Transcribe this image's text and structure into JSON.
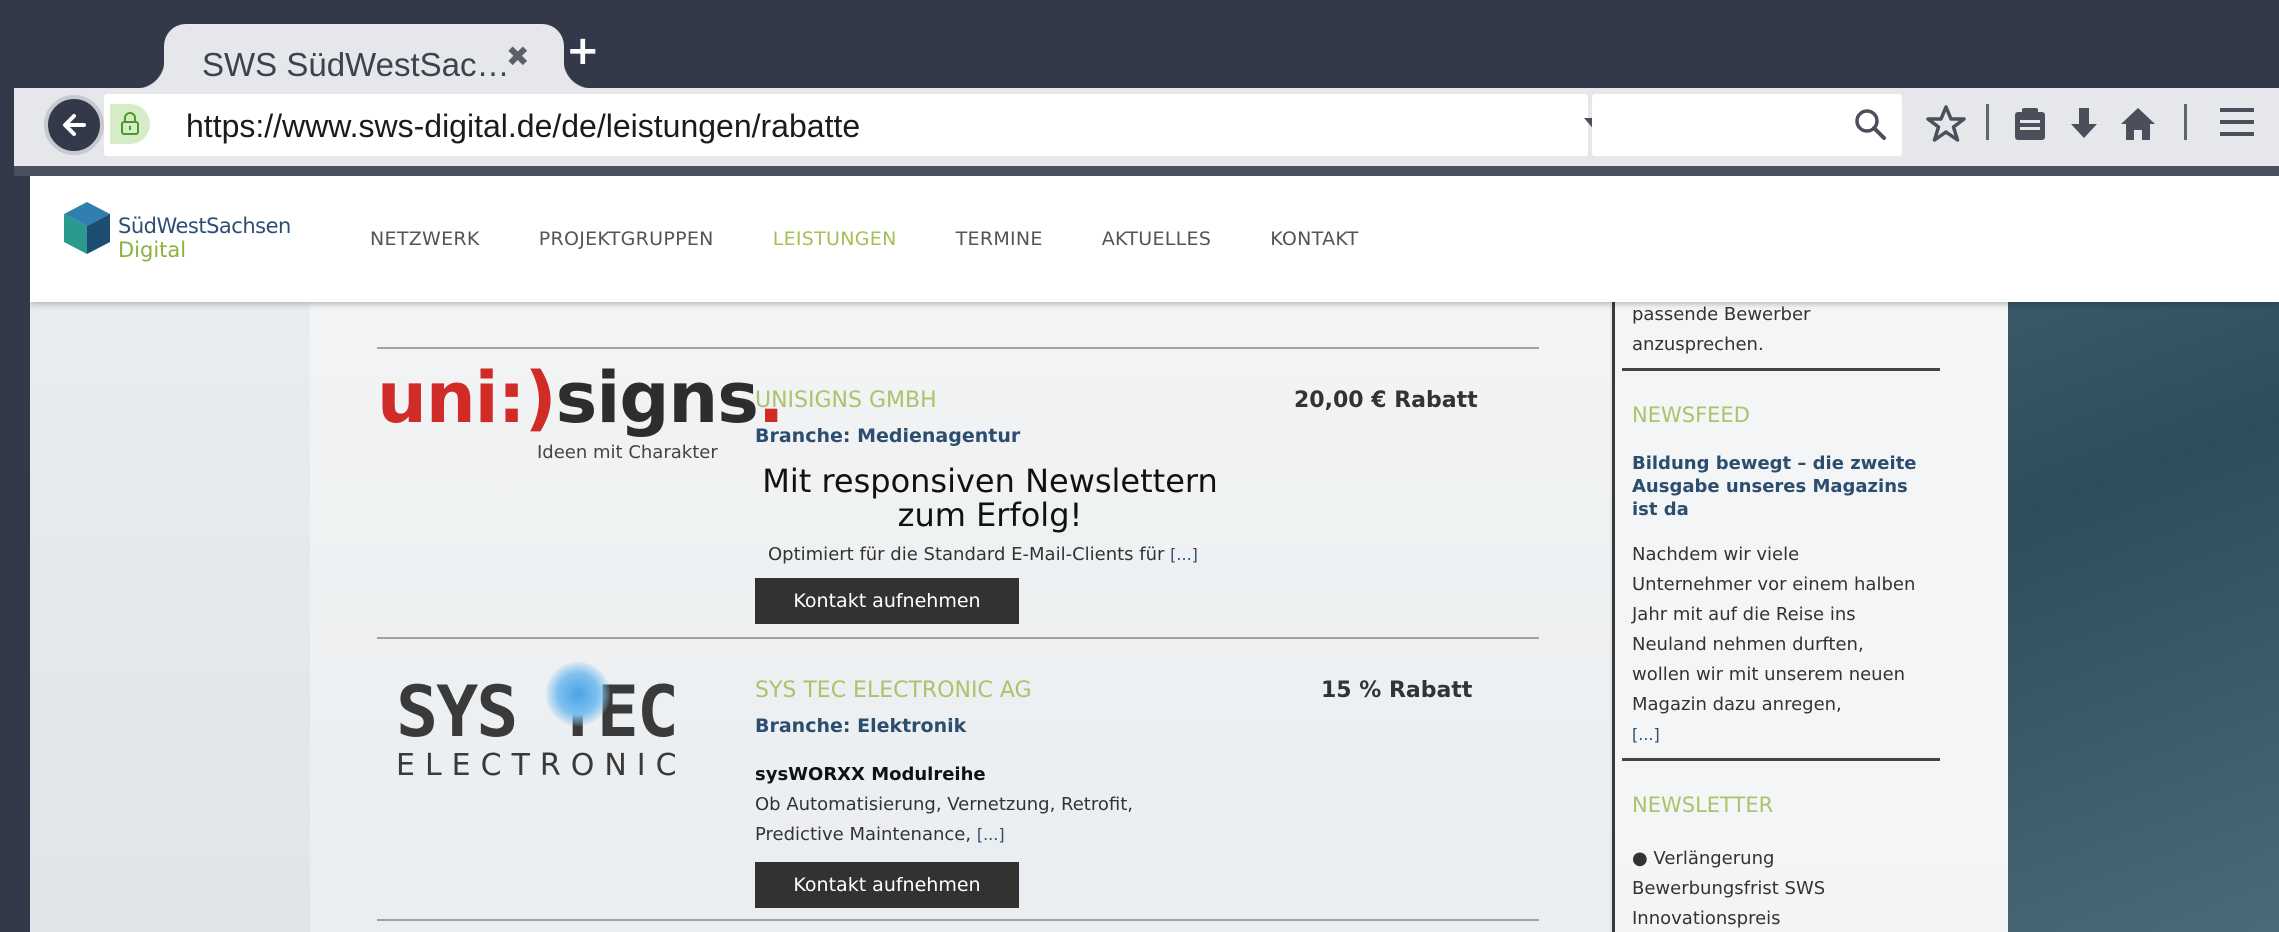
{
  "browser": {
    "tab_title": "SWS SüdWestSac…",
    "tab_close": "✖",
    "new_tab": "+",
    "url": "https://www.sws-digital.de/de/leistungen/rabatte",
    "search_placeholder": ""
  },
  "site": {
    "logo_line1": "SüdWestSachsen",
    "logo_line2": "Digital",
    "nav": [
      "NETZWERK",
      "PROJEKTGRUPPEN",
      "LEISTUNGEN",
      "TERMINE",
      "AKTUELLES",
      "KONTAKT"
    ],
    "active_nav": "LEISTUNGEN"
  },
  "listings": [
    {
      "logo_text_red": "uni:)",
      "logo_text_dark": "signs",
      "logo_text_dot": ".",
      "logo_sub": "Ideen mit Charakter",
      "company": "UNISIGNS GMBH",
      "branch": "Branche: Medienagentur",
      "rabatt": "20,00 € Rabatt",
      "headline": "Mit responsiven Newslettern zum Erfolg!",
      "text": "Optimiert für die Standard E-Mail-Clients für",
      "more": "[...]",
      "button": "Kontakt aufnehmen"
    },
    {
      "logo_main": "SYS TEC",
      "logo_sub": "ELECTRONIC",
      "company": "SYS TEC ELECTRONIC AG",
      "branch": "Branche: Elektronik",
      "rabatt": "15 % Rabatt",
      "headline": "sysWORXX Modulreihe",
      "text_line1": "Ob Automatisierung, Vernetzung, Retrofit,",
      "text_line2": "Predictive Maintenance,",
      "more": "[...]",
      "button": "Kontakt aufnehmen"
    }
  ],
  "sidebar": {
    "intro_line1": "passende Bewerber",
    "intro_line2": "anzusprechen.",
    "newsfeed_heading": "NEWSFEED",
    "newsfeed_link": "Bildung bewegt – die zweite Ausgabe unseres Magazins ist da",
    "newsfeed_text": [
      "Nachdem wir viele",
      "Unternehmer vor einem halben",
      "Jahr mit auf die Reise ins",
      "Neuland nehmen durften,",
      "wollen wir mit unserem neuen",
      "Magazin dazu anregen,"
    ],
    "newsfeed_more": "[...]",
    "newsletter_heading": "NEWSLETTER",
    "newsletter_items": [
      "● Verlängerung",
      "Bewerbungsfrist SWS",
      "Innovationspreis"
    ]
  },
  "colors": {
    "chrome": "#34394a",
    "accent_green": "#a9c46a",
    "link_blue": "#2c4d6e",
    "button_dark": "#333231"
  },
  "icons": [
    "back-arrow-icon",
    "lock-icon",
    "dropdown-icon",
    "reload-icon",
    "search-icon",
    "star-icon",
    "reading-list-icon",
    "download-icon",
    "home-icon",
    "menu-icon"
  ]
}
